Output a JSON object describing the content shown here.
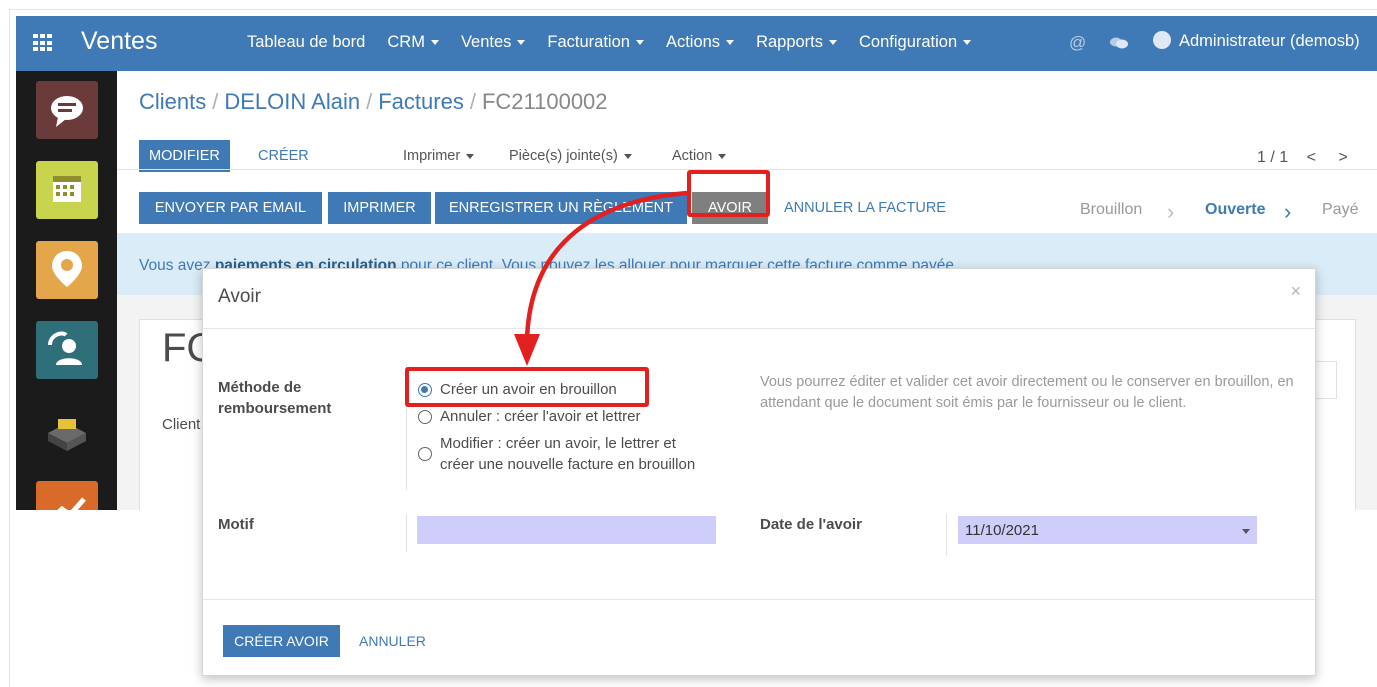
{
  "topbar": {
    "brand": "Ventes",
    "menu": [
      "Tableau de bord",
      "CRM",
      "Ventes",
      "Facturation",
      "Actions",
      "Rapports",
      "Configuration"
    ],
    "user": "Administrateur (demosb)"
  },
  "breadcrumb": {
    "clients": "Clients",
    "customer": "DELOIN Alain",
    "invoices": "Factures",
    "current": "FC21100002"
  },
  "control_panel": {
    "edit": "MODIFIER",
    "create": "CRÉER",
    "print": "Imprimer",
    "attachments": "Pièce(s) jointe(s)",
    "action": "Action",
    "pager": "1 / 1"
  },
  "statusbar": {
    "send_email": "ENVOYER PAR EMAIL",
    "print": "IMPRIMER",
    "register_payment": "ENREGISTRER UN RÈGLEMENT",
    "credit_note": "AVOIR",
    "cancel_invoice": "ANNULER LA FACTURE",
    "states": [
      "Brouillon",
      "Ouverte",
      "Payé"
    ],
    "active_state": "Ouverte"
  },
  "alert": {
    "before": "Vous avez ",
    "bold": "paiements en circulation",
    "after": " pour ce client. Vous pouvez les allouer pour marquer cette facture comme payée."
  },
  "sheet": {
    "title": "FC",
    "client_label": "Client"
  },
  "modal": {
    "title": "Avoir",
    "close": "×",
    "method_label_line1": "Méthode de",
    "method_label_line2": "remboursement",
    "options": [
      "Créer un avoir en brouillon",
      "Annuler : créer l'avoir et lettrer",
      "Modifier : créer un avoir, le lettrer et créer une nouvelle facture en brouillon"
    ],
    "option_line_break": [
      "Modifier : créer un avoir, le lettrer et",
      "créer une nouvelle facture en brouillon"
    ],
    "selected_option": 0,
    "help_text": "Vous pourrez éditer et valider cet avoir directement ou le conserver en brouillon, en attendant que le document soit émis par le fournisseur ou le client.",
    "reason_label": "Motif",
    "reason_value": "",
    "date_label": "Date de l'avoir",
    "date_value": "11/10/2021",
    "create_button": "CRÉER AVOIR",
    "cancel_button": "ANNULER"
  },
  "colors": {
    "brand_blue": "#3f79b6",
    "annotation_red": "#e2201f",
    "input_fill": "#cfcdfa"
  }
}
